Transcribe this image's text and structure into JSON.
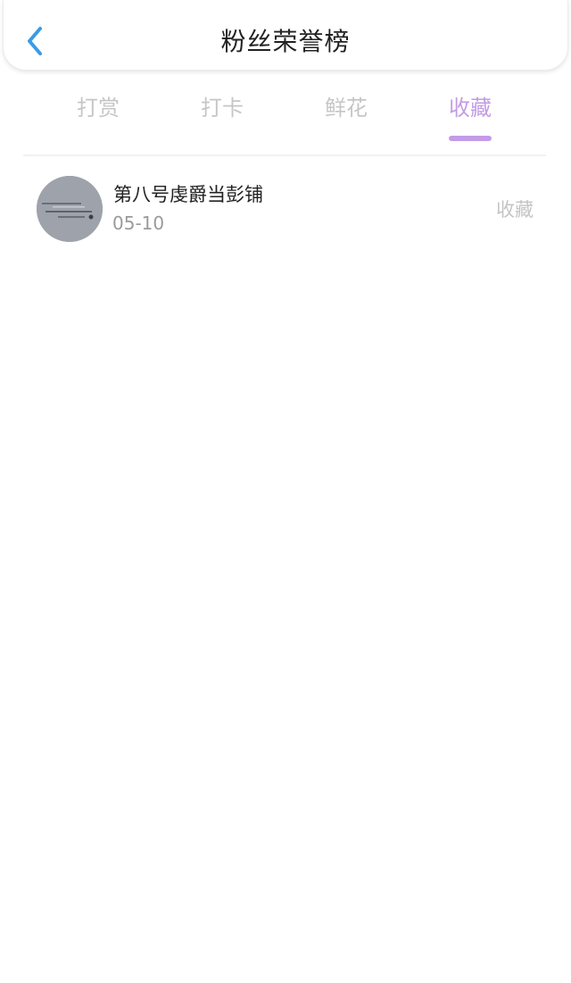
{
  "header": {
    "title": "粉丝荣誉榜",
    "back_icon": "chevron-left-icon",
    "accent_color": "#3a9be6"
  },
  "tabs": {
    "items": [
      {
        "label": "打赏",
        "active": false
      },
      {
        "label": "打卡",
        "active": false
      },
      {
        "label": "鲜花",
        "active": false
      },
      {
        "label": "收藏",
        "active": true
      }
    ],
    "active_color": "#c39be6",
    "inactive_color": "#c6c6c6"
  },
  "list": {
    "items": [
      {
        "name": "第八号虔爵当彭铺",
        "date": "05-10",
        "action": "收藏",
        "avatar": "avatar-image"
      }
    ]
  }
}
